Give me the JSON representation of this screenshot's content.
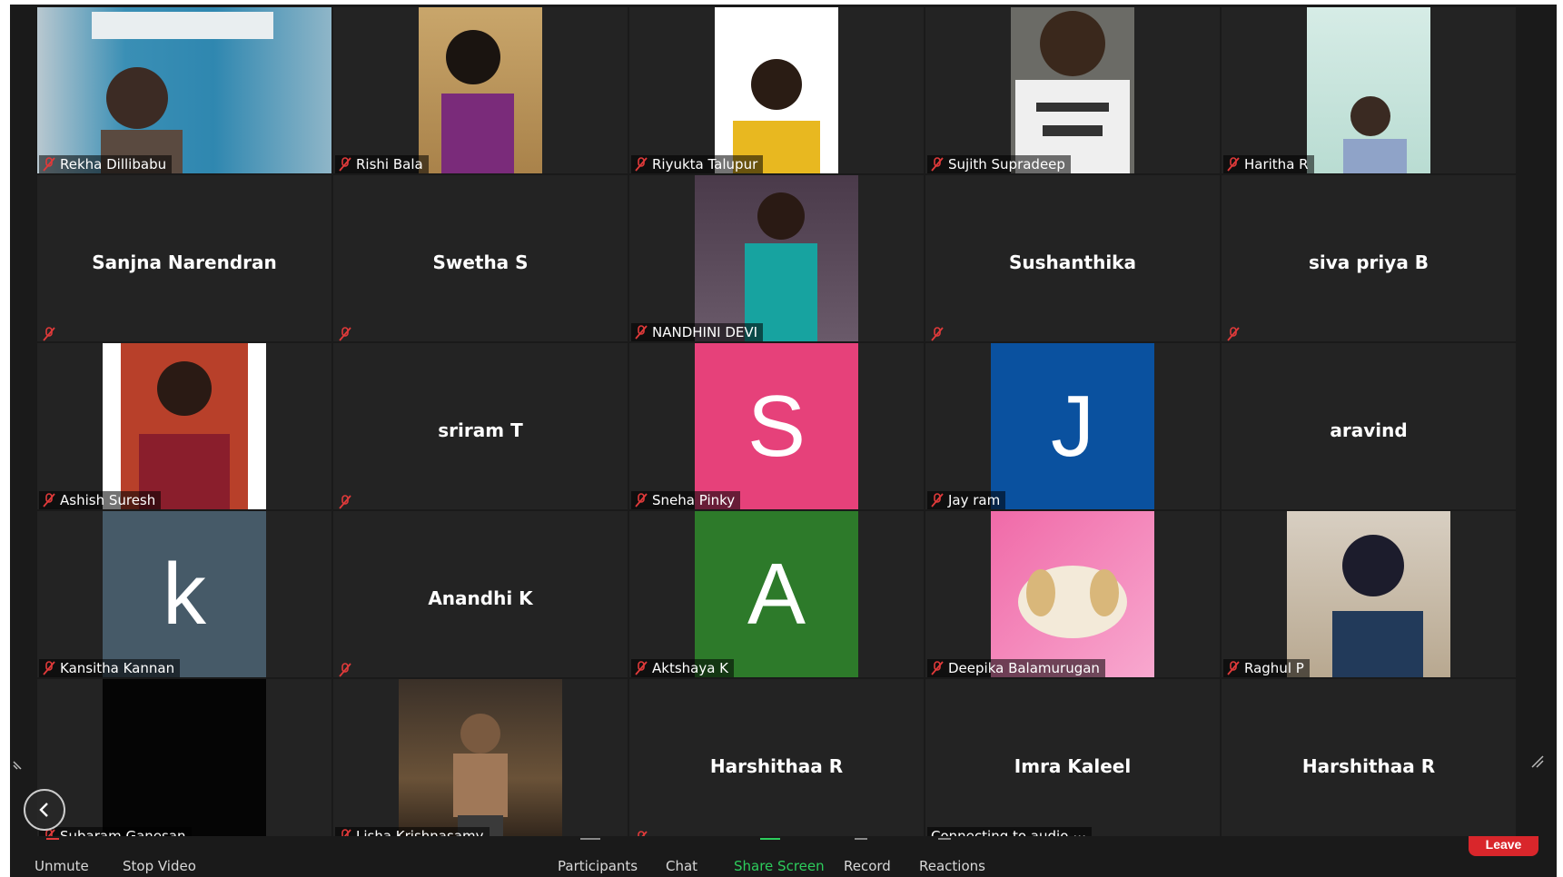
{
  "app": {
    "accent_green": "#2dcc5c",
    "leave_red": "#d9262b"
  },
  "tiles": [
    {
      "name": "Rekha Dillibabu",
      "show_center": false
    },
    {
      "name": "Rishi Bala",
      "show_center": false
    },
    {
      "name": "Riyukta Talupur",
      "show_center": false
    },
    {
      "name": "Sujith Supradeep",
      "show_center": false
    },
    {
      "name": "Haritha R",
      "show_center": false
    },
    {
      "name": "Sanjna Narendran",
      "show_center": true
    },
    {
      "name": "Swetha S",
      "show_center": true
    },
    {
      "name": "NANDHINI DEVI",
      "show_center": false
    },
    {
      "name": "Sushanthika",
      "show_center": true
    },
    {
      "name": "siva priya B",
      "show_center": true
    },
    {
      "name": "Ashish Suresh",
      "show_center": false
    },
    {
      "name": "sriram T",
      "show_center": true
    },
    {
      "name": "Sneha Pinky",
      "avatar_letter": "S",
      "avatar_color": "#e6417a"
    },
    {
      "name": "Jay ram",
      "avatar_letter": "J",
      "avatar_color": "#0a519f"
    },
    {
      "name": "aravind",
      "show_center": true
    },
    {
      "name": "Kansitha Kannan",
      "avatar_letter": "k",
      "avatar_color": "#465a68"
    },
    {
      "name": "Anandhi K",
      "show_center": true
    },
    {
      "name": "Aktshaya K",
      "avatar_letter": "A",
      "avatar_color": "#2d7a2a"
    },
    {
      "name": "Deepika Balamurugan",
      "show_center": false
    },
    {
      "name": "Raghul P",
      "show_center": false
    },
    {
      "name": "Subaram Ganesan",
      "show_center": false
    },
    {
      "name": "Lisha Krishnasamy",
      "show_center": false
    },
    {
      "name": "Harshithaa R",
      "show_center": true
    },
    {
      "name": "Imra Kaleel",
      "show_center": true,
      "status": "Connecting to audio"
    },
    {
      "name": "Harshithaa R",
      "show_center": true
    }
  ],
  "toolbar": {
    "unmute": "Unmute",
    "stop_video": "Stop Video",
    "participants": "Participants",
    "chat": "Chat",
    "share_screen": "Share Screen",
    "record": "Record",
    "reactions": "Reactions",
    "leave": "Leave"
  },
  "icons": [
    "mic-muted-icon",
    "chevron-left-icon",
    "resize-icon",
    "more-icon"
  ]
}
